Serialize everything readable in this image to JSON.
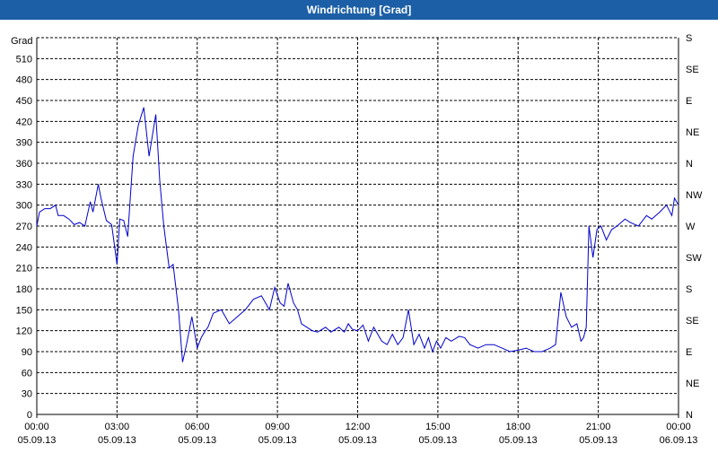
{
  "window": {
    "title": "Windrichtung [Grad]"
  },
  "colors": {
    "titlebar": "#1c5fa6",
    "line": "#0000cc",
    "grid": "#000000"
  },
  "chart_data": {
    "type": "line",
    "title": "Windrichtung [Grad]",
    "ylabel": "Grad",
    "xlabel": "",
    "ylim": [
      0,
      540
    ],
    "xlim_hours": [
      0,
      24
    ],
    "grid": true,
    "y_ticks": [
      0,
      30,
      60,
      90,
      120,
      150,
      180,
      210,
      240,
      270,
      300,
      330,
      360,
      390,
      420,
      450,
      480,
      510
    ],
    "y_right_ticks": [
      {
        "value": 0,
        "label": "N"
      },
      {
        "value": 45,
        "label": "NE"
      },
      {
        "value": 90,
        "label": "E"
      },
      {
        "value": 135,
        "label": "SE"
      },
      {
        "value": 180,
        "label": "S"
      },
      {
        "value": 225,
        "label": "SW"
      },
      {
        "value": 270,
        "label": "W"
      },
      {
        "value": 315,
        "label": "NW"
      },
      {
        "value": 360,
        "label": "N"
      },
      {
        "value": 405,
        "label": "NE"
      },
      {
        "value": 450,
        "label": "E"
      },
      {
        "value": 495,
        "label": "SE"
      },
      {
        "value": 540,
        "label": "S"
      }
    ],
    "x_ticks": [
      {
        "hour": 0,
        "time": "00:00",
        "date": "05.09.13"
      },
      {
        "hour": 3,
        "time": "03:00",
        "date": "05.09.13"
      },
      {
        "hour": 6,
        "time": "06:00",
        "date": "05.09.13"
      },
      {
        "hour": 9,
        "time": "09:00",
        "date": "05.09.13"
      },
      {
        "hour": 12,
        "time": "12:00",
        "date": "05.09.13"
      },
      {
        "hour": 15,
        "time": "15:00",
        "date": "05.09.13"
      },
      {
        "hour": 18,
        "time": "18:00",
        "date": "05.09.13"
      },
      {
        "hour": 21,
        "time": "21:00",
        "date": "05.09.13"
      },
      {
        "hour": 24,
        "time": "00:00",
        "date": "06.09.13"
      }
    ],
    "series": [
      {
        "x": [
          0,
          0.1,
          0.3,
          0.5,
          0.7,
          0.8,
          1.0,
          1.2,
          1.4,
          1.6,
          1.8,
          2.0,
          2.1,
          2.3,
          2.4,
          2.6,
          2.8,
          3.0,
          3.1,
          3.25,
          3.4,
          3.6,
          3.8,
          4.0,
          4.2,
          4.45,
          4.6,
          4.75,
          4.95,
          5.1,
          5.3,
          5.45,
          5.6,
          5.8,
          6.0,
          6.15,
          6.3,
          6.4,
          6.6,
          6.9,
          7.2,
          7.5,
          7.8,
          8.1,
          8.4,
          8.7,
          8.9,
          9.1,
          9.25,
          9.4,
          9.6,
          9.75,
          9.9,
          10.1,
          10.3,
          10.5,
          10.8,
          11.0,
          11.3,
          11.5,
          11.65,
          11.8,
          12.0,
          12.2,
          12.4,
          12.6,
          12.9,
          13.1,
          13.3,
          13.5,
          13.7,
          13.9,
          14.1,
          14.3,
          14.5,
          14.65,
          14.8,
          14.95,
          15.1,
          15.3,
          15.5,
          15.8,
          16.0,
          16.2,
          16.5,
          16.8,
          17.1,
          17.4,
          17.7,
          18.0,
          18.3,
          18.6,
          18.9,
          19.2,
          19.4,
          19.6,
          19.8,
          20.0,
          20.2,
          20.35,
          20.45,
          20.55,
          20.65,
          20.8,
          20.95,
          21.1,
          21.3,
          21.5,
          21.7,
          22.0,
          22.2,
          22.5,
          22.8,
          23.0,
          23.3,
          23.55,
          23.75,
          23.85,
          24.0
        ],
        "y": [
          270,
          290,
          295,
          295,
          300,
          285,
          285,
          280,
          272,
          275,
          270,
          305,
          290,
          330,
          310,
          278,
          272,
          215,
          280,
          278,
          255,
          370,
          415,
          440,
          370,
          430,
          335,
          270,
          210,
          215,
          150,
          75,
          100,
          140,
          95,
          110,
          120,
          125,
          145,
          150,
          130,
          140,
          150,
          165,
          170,
          150,
          182,
          160,
          155,
          188,
          160,
          150,
          130,
          125,
          120,
          118,
          125,
          118,
          125,
          118,
          130,
          122,
          120,
          128,
          105,
          125,
          105,
          100,
          115,
          100,
          110,
          150,
          100,
          115,
          95,
          110,
          90,
          105,
          95,
          110,
          105,
          112,
          110,
          100,
          95,
          100,
          100,
          95,
          90,
          92,
          95,
          90,
          90,
          95,
          100,
          175,
          140,
          125,
          130,
          105,
          110,
          125,
          270,
          225,
          265,
          270,
          250,
          265,
          270,
          280,
          275,
          270,
          285,
          280,
          290,
          300,
          285,
          310,
          300
        ]
      }
    ]
  }
}
